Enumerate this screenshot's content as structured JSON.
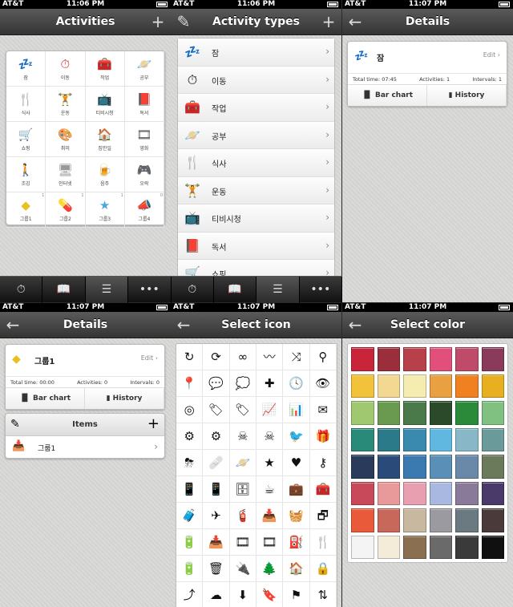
{
  "status": {
    "carrier": "AT&T",
    "times": [
      "11:06 PM",
      "11:06 PM",
      "11:07 PM",
      "11:07 PM",
      "11:07 PM",
      "11:07 PM"
    ]
  },
  "activities": {
    "title": "Activities",
    "add": "+",
    "items": [
      {
        "label": "잠",
        "icon": "💤",
        "color": "#7a5a8a"
      },
      {
        "label": "이동",
        "icon": "⏱",
        "color": "#c33"
      },
      {
        "label": "작업",
        "icon": "🧰",
        "color": "#e87a1a"
      },
      {
        "label": "공부",
        "icon": "🪐",
        "color": "#b9a07a"
      },
      {
        "label": "식사",
        "icon": "🍴",
        "color": "#4a6a2a"
      },
      {
        "label": "운동",
        "icon": "🏋",
        "color": "#2a5aa0"
      },
      {
        "label": "티비시청",
        "icon": "📺",
        "color": "#7a5a2a"
      },
      {
        "label": "독서",
        "icon": "📕",
        "color": "#8a5a3a"
      },
      {
        "label": "쇼핑",
        "icon": "🛒",
        "color": "#2a6a4a"
      },
      {
        "label": "취미",
        "icon": "🎨",
        "color": "#3a6aa0"
      },
      {
        "label": "집안일",
        "icon": "🏠",
        "color": "#3a8a3a"
      },
      {
        "label": "영화",
        "icon": "🎞",
        "color": "#555"
      },
      {
        "label": "조깅",
        "icon": "🚶",
        "color": "#3a6ab0"
      },
      {
        "label": "인터넷",
        "icon": "🖥",
        "color": "#999"
      },
      {
        "label": "음주",
        "icon": "🍺",
        "color": "#c22"
      },
      {
        "label": "오락",
        "icon": "🎮",
        "color": "#8a6a4a"
      },
      {
        "label": "그룹1",
        "icon": "◆",
        "color": "#e8c020",
        "count": "1"
      },
      {
        "label": "그룹2",
        "icon": "💊",
        "color": "#9acb5a",
        "count": "1"
      },
      {
        "label": "그룹3",
        "icon": "★",
        "color": "#4aaadd",
        "count": "1"
      },
      {
        "label": "그룹4",
        "icon": "📣",
        "color": "#3a8ac0",
        "count": "0"
      }
    ]
  },
  "types": {
    "title": "Activity types",
    "add": "+",
    "items": [
      {
        "label": "잠",
        "icon": "💤"
      },
      {
        "label": "이동",
        "icon": "⏱"
      },
      {
        "label": "작업",
        "icon": "🧰"
      },
      {
        "label": "공부",
        "icon": "🪐"
      },
      {
        "label": "식사",
        "icon": "🍴"
      },
      {
        "label": "운동",
        "icon": "🏋"
      },
      {
        "label": "티비시청",
        "icon": "📺"
      },
      {
        "label": "독서",
        "icon": "📕"
      },
      {
        "label": "쇼핑",
        "icon": "🛒"
      }
    ]
  },
  "tabbar": [
    "⏱",
    "📖",
    "☰",
    "•••",
    "⏱",
    "📖",
    "☰",
    "•••"
  ],
  "details1": {
    "title": "Details",
    "name": "잠",
    "icon": "💤",
    "edit": "Edit",
    "total": "Total time: 07:45",
    "activities": "Activities: 1",
    "intervals": "Intervals: 1",
    "bar": "Bar chart",
    "history": "History"
  },
  "details2": {
    "title": "Details",
    "name": "그룹1",
    "icon": "◆",
    "edit": "Edit",
    "total": "Total time: 00:00",
    "activities": "Activities: 0",
    "intervals": "Intervals: 0",
    "bar": "Bar chart",
    "history": "History",
    "items_title": "Items",
    "item": "그룹1"
  },
  "icons": {
    "title": "Select icon",
    "glyphs": [
      "↻",
      "⟳",
      "∞",
      "〰",
      "⤨",
      "⚲",
      "📍",
      "💬",
      "💭",
      "✚",
      "🕓",
      "👁",
      "◎",
      "🏷",
      "🏷",
      "📈",
      "📊",
      "✉",
      "⚙",
      "⚙",
      "☠",
      "☠",
      "🐦",
      "🎁",
      "⛈",
      "🩹",
      "🪐",
      "★",
      "♥",
      "⚷",
      "📱",
      "📱",
      "🗄",
      "☕",
      "💼",
      "🧰",
      "🧳",
      "✈",
      "🧯",
      "📥",
      "🧺",
      "🗗",
      "🔋",
      "📥",
      "🎞",
      "🎞",
      "⛽",
      "🍴",
      "🔋",
      "🗑",
      "🔌",
      "🌲",
      "🏠",
      "🔒",
      "⤴",
      "☁",
      "⬇",
      "🔖",
      "⚑",
      "⇅"
    ]
  },
  "colors": {
    "title": "Select color",
    "swatches": [
      "#c8243a",
      "#9a2e3a",
      "#b8404a",
      "#e0507a",
      "#c04a6a",
      "#8a3a5a",
      "#f2c23a",
      "#f2d890",
      "#f4ecb0",
      "#e8a040",
      "#f08020",
      "#e8b020",
      "#a0c870",
      "#6a9a50",
      "#4a7a4a",
      "#2a4a2a",
      "#2a8a3a",
      "#80c080",
      "#2a8a7a",
      "#2a7a8a",
      "#3a8ab0",
      "#60b8e0",
      "#88b8c8",
      "#6a9a9a",
      "#2a3a5a",
      "#2a4a7a",
      "#3a7ab0",
      "#5a90b8",
      "#6a88a8",
      "#6a7a5a",
      "#c84a5a",
      "#e89a9a",
      "#e8a0b0",
      "#a8b8e0",
      "#8a7a9a",
      "#4a3a6a",
      "#e85a3a",
      "#c8685a",
      "#c8b8a0",
      "#9a9aa0",
      "#6a7a80",
      "#4a3a3a",
      "#f4f4f4",
      "#f4ecd8",
      "#8a7050",
      "#6a6a6a",
      "#3a3a3a",
      "#101010"
    ]
  }
}
